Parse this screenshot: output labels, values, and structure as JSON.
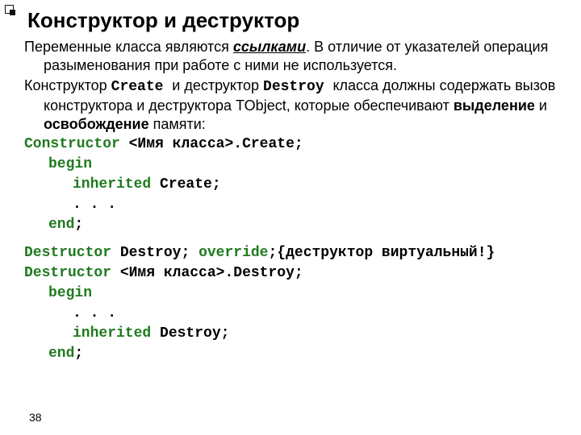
{
  "page_number": "38",
  "title": "Конструктор и деструктор",
  "p1": {
    "t1": "Переменные класса являются ",
    "t2": "ссылками",
    "t3": ". В отличие от указателей операция разыменования при работе с ними не используется."
  },
  "p2": {
    "t1": "Конструктор ",
    "t2": "Create ",
    "t3": " и деструктор ",
    "t4": "Destroy ",
    "t5": " класса должны содержать вызов конструктора и деструктора TObject, которые обеспечивают ",
    "t6": "выделение",
    "t7": " и ",
    "t8": "освобождение",
    "t9": " памяти:"
  },
  "ctor": {
    "kw": "Constructor",
    "rest": " <Имя класса>.",
    "create": "Create",
    "semi": ";",
    "begin": "begin",
    "inherited": "inherited",
    "inh_rest": " Create;",
    "dots": ".  .  .",
    "end": "end",
    "endsemi": ";"
  },
  "dtor": {
    "kw": "Destructor",
    "decl_rest": " Destroy; ",
    "override": "override",
    "decl_semi": ";",
    "comment": "{деструктор виртуальный!}",
    "impl_rest": " <Имя класса>.",
    "destroy": "Destroy",
    "semi": ";",
    "begin": "begin",
    "dots": ".  .  .",
    "inherited": "inherited",
    "inh_rest": " Destroy;",
    "end": "end",
    "endsemi": ";"
  }
}
